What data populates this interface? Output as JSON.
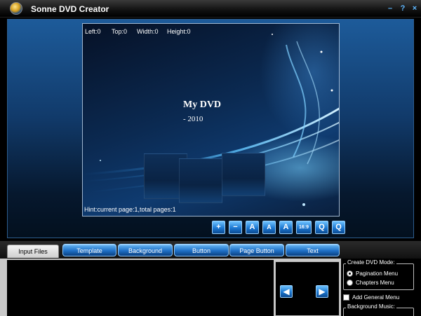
{
  "app": {
    "title": "Sonne DVD Creator"
  },
  "window_controls": {
    "minimize": "–",
    "help": "?",
    "close": "×"
  },
  "preview": {
    "coords": {
      "left": "Left:0",
      "top": "Top:0",
      "width": "Width:0",
      "height": "Height:0"
    },
    "menu_title": "My DVD",
    "menu_subtitle": "- 2010",
    "hint": "Hint:current page:1,total pages:1"
  },
  "tools": [
    {
      "name": "add-icon",
      "glyph": "+"
    },
    {
      "name": "remove-icon",
      "glyph": "−"
    },
    {
      "name": "font-larger-icon",
      "glyph": "A"
    },
    {
      "name": "font-smaller-icon",
      "glyph": "A"
    },
    {
      "name": "color-icon",
      "glyph": "A"
    },
    {
      "name": "aspect-ratio-icon",
      "glyph": "16:9"
    },
    {
      "name": "zoom-in-icon",
      "glyph": "Q"
    },
    {
      "name": "zoom-out-icon",
      "glyph": "Q"
    }
  ],
  "tabs": {
    "input_files": "Input Files",
    "template": "Template",
    "background": "Background",
    "button": "Button",
    "page_button": "Page Button",
    "text": "Text"
  },
  "navigation": {
    "prev": "◀",
    "next": "▶"
  },
  "options": {
    "create_mode_legend": "Create DVD Mode:",
    "pagination_menu": "Pagination Menu",
    "chapters_menu": "Chapters Menu",
    "selected_mode": "Pagination Menu",
    "add_general_menu": "Add General Menu",
    "background_music_legend": "Background Music:"
  }
}
